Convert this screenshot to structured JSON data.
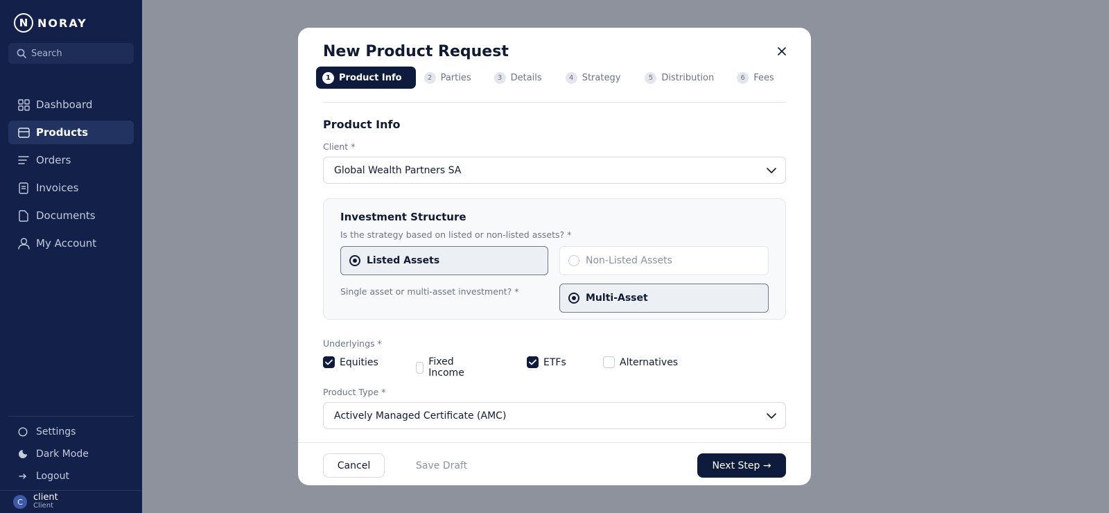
{
  "brand": {
    "logo_letter": "N",
    "name": "NORAY"
  },
  "sidebar": {
    "search_placeholder": "Search",
    "items": [
      {
        "label": "Dashboard",
        "icon": "grid-icon",
        "active": false
      },
      {
        "label": "Products",
        "icon": "card-icon",
        "active": true
      },
      {
        "label": "Orders",
        "icon": "list-icon",
        "active": false
      },
      {
        "label": "Invoices",
        "icon": "receipt-icon",
        "active": false
      },
      {
        "label": "Documents",
        "icon": "file-icon",
        "active": false
      },
      {
        "label": "My Account",
        "icon": "user-icon",
        "active": false
      }
    ],
    "bottom": {
      "settings": "Settings",
      "dark_mode": "Dark Mode",
      "logout": "Logout"
    },
    "user": {
      "initial": "C",
      "name": "client",
      "role": "Client"
    }
  },
  "modal": {
    "title": "New Product Request",
    "steps": [
      {
        "num": "1",
        "label": "Product Info",
        "active": true
      },
      {
        "num": "2",
        "label": "Parties",
        "active": false
      },
      {
        "num": "3",
        "label": "Details",
        "active": false
      },
      {
        "num": "4",
        "label": "Strategy",
        "active": false
      },
      {
        "num": "5",
        "label": "Distribution",
        "active": false
      },
      {
        "num": "6",
        "label": "Fees",
        "active": false
      }
    ],
    "section_title": "Product Info",
    "client": {
      "label": "Client *",
      "value": "Global Wealth Partners SA"
    },
    "structure": {
      "title": "Investment Structure",
      "q1": "Is the strategy based on listed or non-listed assets? *",
      "q1_options": [
        "Listed Assets",
        "Non-Listed Assets"
      ],
      "q1_selected": "Listed Assets",
      "q2": "Single asset or multi-asset investment? *",
      "q2_option": "Multi-Asset",
      "q2_selected": "Multi-Asset"
    },
    "underlyings": {
      "label": "Underlyings *",
      "options": [
        {
          "label": "Equities",
          "checked": true
        },
        {
          "label": "Fixed Income",
          "checked": false
        },
        {
          "label": "ETFs",
          "checked": true
        },
        {
          "label": "Alternatives",
          "checked": false
        }
      ]
    },
    "product_type": {
      "label": "Product Type *",
      "value": "Actively Managed Certificate (AMC)"
    },
    "footer": {
      "cancel": "Cancel",
      "save_draft": "Save Draft",
      "next": "Next Step →"
    }
  },
  "colors": {
    "sidebar_bg": "#13204a",
    "accent": "#0f1b3d",
    "overlay": "#8e929c"
  }
}
